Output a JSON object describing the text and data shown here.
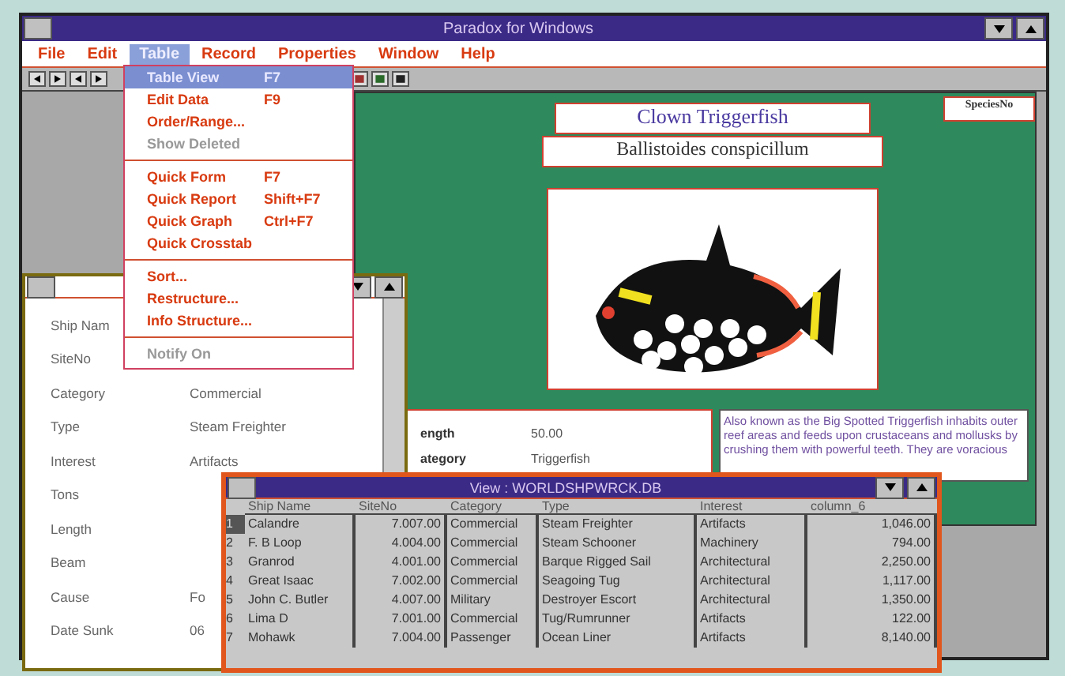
{
  "window": {
    "title": "Paradox for Windows"
  },
  "menu_bar": [
    {
      "label": "File",
      "selected": false
    },
    {
      "label": "Edit",
      "selected": false
    },
    {
      "label": "Table",
      "selected": true
    },
    {
      "label": "Record",
      "selected": false
    },
    {
      "label": "Properties",
      "selected": false
    },
    {
      "label": "Window",
      "selected": false
    },
    {
      "label": "Help",
      "selected": false
    }
  ],
  "dropdown_menu": [
    {
      "kind": "item",
      "label": "Table View",
      "shortcut": "F7",
      "selected": true,
      "disabled": false
    },
    {
      "kind": "item",
      "label": "Edit Data",
      "shortcut": "F9",
      "selected": false,
      "disabled": false
    },
    {
      "kind": "item",
      "label": "Order/Range...",
      "selected": false,
      "disabled": false
    },
    {
      "kind": "item",
      "label": "Show Deleted",
      "selected": false,
      "disabled": true
    },
    {
      "kind": "separator"
    },
    {
      "kind": "item",
      "label": "Quick Form",
      "shortcut": "F7",
      "selected": false,
      "disabled": false
    },
    {
      "kind": "item",
      "label": "Quick Report",
      "shortcut": "Shift+F7",
      "selected": false,
      "disabled": false
    },
    {
      "kind": "item",
      "label": "Quick Graph",
      "shortcut": "Ctrl+F7",
      "selected": false,
      "disabled": false
    },
    {
      "kind": "item",
      "label": "Quick Crosstab",
      "selected": false,
      "disabled": false
    },
    {
      "kind": "separator"
    },
    {
      "kind": "item",
      "label": "Sort...",
      "selected": false,
      "disabled": false
    },
    {
      "kind": "item",
      "label": "Restructure...",
      "selected": false,
      "disabled": false
    },
    {
      "kind": "item",
      "label": "Info Structure...",
      "selected": false,
      "disabled": false
    },
    {
      "kind": "separator"
    },
    {
      "kind": "item",
      "label": "Notify On",
      "selected": false,
      "disabled": true
    }
  ],
  "species_form": {
    "common_name": "Clown Triggerfish",
    "scientific_name": "Ballistoides conspicillum",
    "species_no_label": "SpeciesNo",
    "fields": [
      {
        "label": "ength",
        "value": "50.00"
      },
      {
        "label": "ategory",
        "value": "Triggerfish"
      }
    ],
    "description": "Also known as the Big Spotted Triggerfish inhabits outer reef areas and feeds upon crustaceans and mollusks by crushing them with powerful teeth. They are voracious"
  },
  "ship_form": {
    "fields": [
      {
        "label": "Ship Nam"
      },
      {
        "label": "SiteNo"
      },
      {
        "label": "Category",
        "value": "Commercial"
      },
      {
        "label": "Type",
        "value": "Steam Freighter"
      },
      {
        "label": "Interest",
        "value": "Artifacts"
      },
      {
        "label": "Tons"
      },
      {
        "label": "Length"
      },
      {
        "label": "Beam"
      },
      {
        "label": "Cause",
        "value": "Fo"
      },
      {
        "label": "Date Sunk",
        "value": "06"
      }
    ]
  },
  "table_view": {
    "title": "View : WORLDSHPWRCK.DB",
    "columns": [
      "Ship Name",
      "SiteNo",
      "Category",
      "Type",
      "Interest",
      "column_6"
    ],
    "rows": [
      {
        "number": "1",
        "selected": true,
        "cells": [
          "Calandre",
          "7.007.00",
          "Commercial",
          "Steam Freighter",
          "Artifacts",
          "1,046.00"
        ]
      },
      {
        "number": "2",
        "selected": false,
        "cells": [
          "F. B Loop",
          "4.004.00",
          "Commercial",
          "Steam Schooner",
          "Machinery",
          "794.00"
        ]
      },
      {
        "number": "3",
        "selected": false,
        "cells": [
          "Granrod",
          "4.001.00",
          "Commercial",
          "Barque Rigged Sail",
          "Architectural",
          "2,250.00"
        ]
      },
      {
        "number": "4",
        "selected": false,
        "cells": [
          "Great Isaac",
          "7.002.00",
          "Commercial",
          "Seagoing Tug",
          "Architectural",
          "1,117.00"
        ]
      },
      {
        "number": "5",
        "selected": false,
        "cells": [
          "John C. Butler",
          "4.007.00",
          "Military",
          "Destroyer Escort",
          "Architectural",
          "1,350.00"
        ]
      },
      {
        "number": "6",
        "selected": false,
        "cells": [
          "Lima D",
          "7.001.00",
          "Commercial",
          "Tug/Rumrunner",
          "Artifacts",
          "122.00"
        ]
      },
      {
        "number": "7",
        "selected": false,
        "cells": [
          "Mohawk",
          "7.004.00",
          "Passenger",
          "Ocean Liner",
          "Artifacts",
          "8,140.00"
        ]
      }
    ]
  }
}
